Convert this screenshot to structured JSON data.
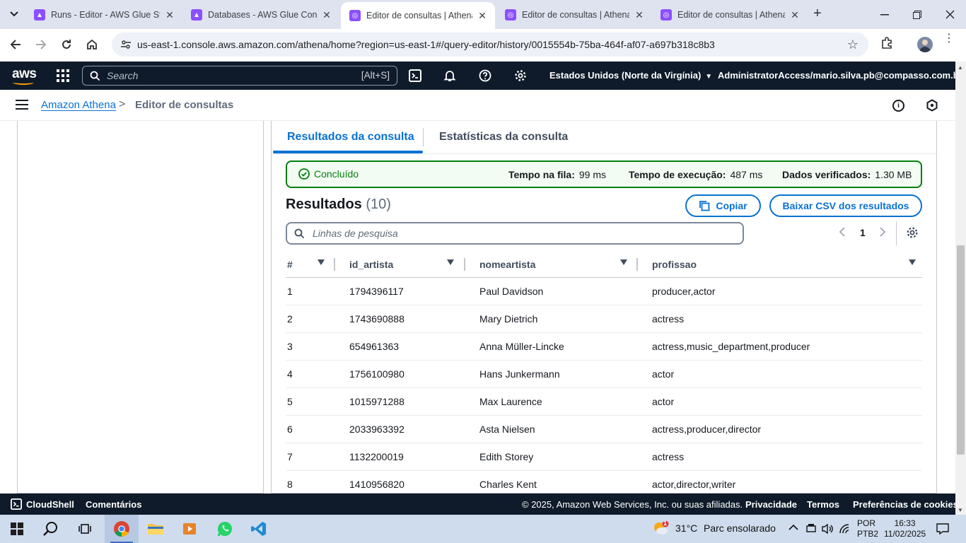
{
  "browser": {
    "tabs": [
      {
        "title": "Runs - Editor - AWS Glue Studio",
        "favicon": "aws-glue-icon",
        "active": false
      },
      {
        "title": "Databases - AWS Glue Console",
        "favicon": "aws-glue-icon",
        "active": false
      },
      {
        "title": "Editor de consultas | Athena",
        "favicon": "athena-icon",
        "active": true
      },
      {
        "title": "Editor de consultas | Athena",
        "favicon": "athena-icon",
        "active": false
      },
      {
        "title": "Editor de consultas | Athena",
        "favicon": "athena-icon",
        "active": false
      }
    ],
    "url": "us-east-1.console.aws.amazon.com/athena/home?region=us-east-1#/query-editor/history/0015554b-75ba-464f-af07-a697b318c8b3"
  },
  "aws_header": {
    "logo": "aws",
    "search_placeholder": "Search",
    "search_shortcut": "[Alt+S]",
    "region": "Estados Unidos (Norte da Virgínia)",
    "account": "AdministratorAccess/mario.silva.pb@compasso.com.br"
  },
  "breadcrumb": {
    "service": "Amazon Athena",
    "separator": ">",
    "current": "Editor de consultas"
  },
  "results_tabs": {
    "results": "Resultados da consulta",
    "stats": "Estatísticas da consulta"
  },
  "status": {
    "state": "Concluído",
    "queue_label": "Tempo na fila:",
    "queue_value": "99 ms",
    "exec_label": "Tempo de execução:",
    "exec_value": "487 ms",
    "scanned_label": "Dados verificados:",
    "scanned_value": "1.30 MB"
  },
  "results": {
    "title": "Resultados",
    "count": "(10)",
    "copy_label": "Copiar",
    "download_label": "Baixar CSV dos resultados",
    "filter_placeholder": "Linhas de pesquisa",
    "page": "1",
    "columns": [
      "#",
      "id_artista",
      "nomeartista",
      "profissao"
    ],
    "rows": [
      [
        "1",
        "1794396117",
        "Paul Davidson",
        "producer,actor"
      ],
      [
        "2",
        "1743690888",
        "Mary Dietrich",
        "actress"
      ],
      [
        "3",
        "654961363",
        "Anna Müller-Lincke",
        "actress,music_department,producer"
      ],
      [
        "4",
        "1756100980",
        "Hans Junkermann",
        "actor"
      ],
      [
        "5",
        "1015971288",
        "Max Laurence",
        "actor"
      ],
      [
        "6",
        "2033963392",
        "Asta Nielsen",
        "actress,producer,director"
      ],
      [
        "7",
        "1132200019",
        "Edith Storey",
        "actress"
      ],
      [
        "8",
        "1410956820",
        "Charles Kent",
        "actor,director,writer"
      ]
    ]
  },
  "footer": {
    "cloudshell": "CloudShell",
    "comments": "Comentários",
    "copyright": "© 2025, Amazon Web Services, Inc. ou suas afiliadas.",
    "privacy": "Privacidade",
    "terms": "Termos",
    "cookies": "Preferências de cookies"
  },
  "taskbar": {
    "weather_temp": "31°C",
    "weather_desc": "Parc ensolarado",
    "weather_badge": "1",
    "lang_top": "POR",
    "lang_bottom": "PTB2",
    "time": "16:33",
    "date": "11/02/2025"
  },
  "colors": {
    "aws_navy": "#0f1b2a",
    "link_blue": "#0972d3",
    "success_green": "#037f0c",
    "aws_orange": "#ff9900"
  }
}
